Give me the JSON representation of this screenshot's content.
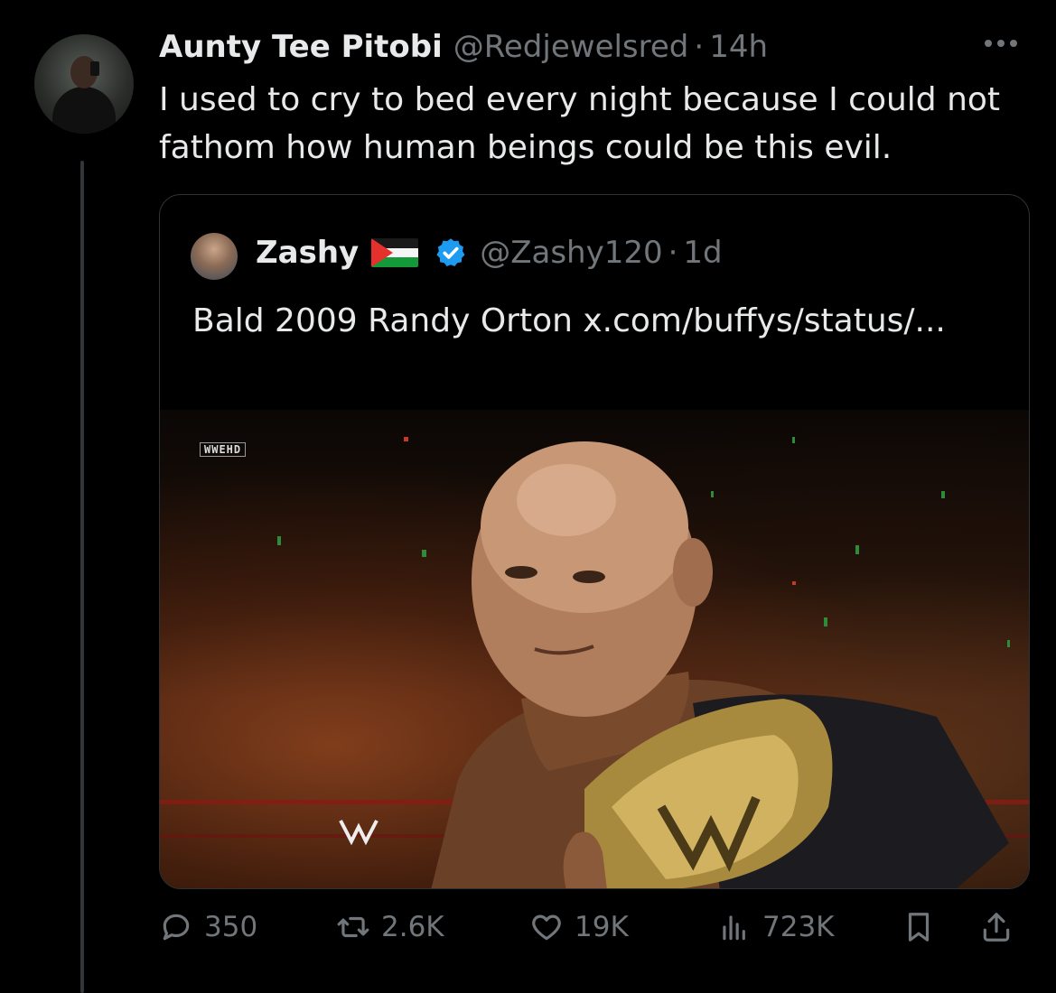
{
  "tweet": {
    "author": {
      "name": "Aunty Tee Pitobi",
      "handle": "@Redjewelsred",
      "separator": "·",
      "time": "14h"
    },
    "text": "I used to cry to bed every night because I could not fathom how human beings could be this evil."
  },
  "quote": {
    "author": {
      "name": "Zashy",
      "flag": "palestine-flag",
      "verified": true,
      "handle": "@Zashy120",
      "separator": "·",
      "time": "1d"
    },
    "text": "Bald 2009 Randy Orton x.com/buffys/status/...",
    "media": {
      "watermark": "WWEHD",
      "type": "image"
    }
  },
  "actions": {
    "replies": "350",
    "reposts": "2.6K",
    "likes": "19K",
    "views": "723K"
  },
  "colors": {
    "background": "#000000",
    "text": "#e7e9ea",
    "muted": "#71767b",
    "verified": "#1d9bf0",
    "border": "#2f3336"
  }
}
